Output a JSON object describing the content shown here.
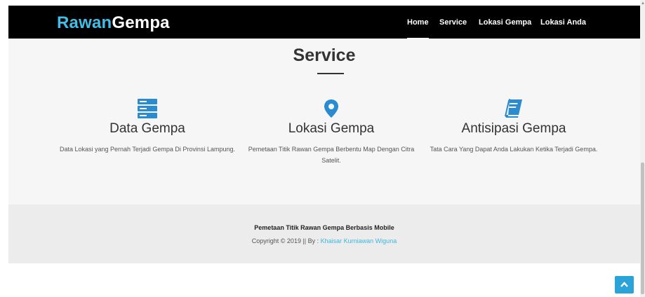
{
  "brand": {
    "part1": "Rawan",
    "part2": "Gempa"
  },
  "nav": {
    "items": [
      {
        "label": "Home"
      },
      {
        "label": "Service"
      },
      {
        "label": "Lokasi Gempa"
      },
      {
        "label": "Lokasi Anda"
      }
    ],
    "active": "Home"
  },
  "section": {
    "title": "Service"
  },
  "services": [
    {
      "icon": "server-icon",
      "title": "Data Gempa",
      "description": "Data Lokasi yang Pernah Terjadi Gempa Di Provinsi Lampung."
    },
    {
      "icon": "map-marker-icon",
      "title": "Lokasi Gempa",
      "description": "Pemetaan Titik Rawan Gempa Berbentu Map Dengan Citra Satelit."
    },
    {
      "icon": "book-icon",
      "title": "Antisipasi Gempa",
      "description": "Tata Cara Yang Dapat Anda Lakukan Ketika Terjadi Gempa."
    }
  ],
  "footer": {
    "title": "Pemetaan Titik Rawan Gempa Berbasis Mobile",
    "copyright_prefix": "Copyright © 2019 || By : ",
    "author": "Khaisar Kurniawan Wiguna"
  },
  "back_to_top": {
    "icon": "chevron-up-icon"
  },
  "colors": {
    "accent": "#41bde6",
    "icon_blue": "#2a8bd1",
    "navbar_bg": "#000000",
    "page_bg": "#f6f6f6",
    "footer_bg": "#ececec",
    "back_to_top_bg": "#2aa4d8"
  }
}
